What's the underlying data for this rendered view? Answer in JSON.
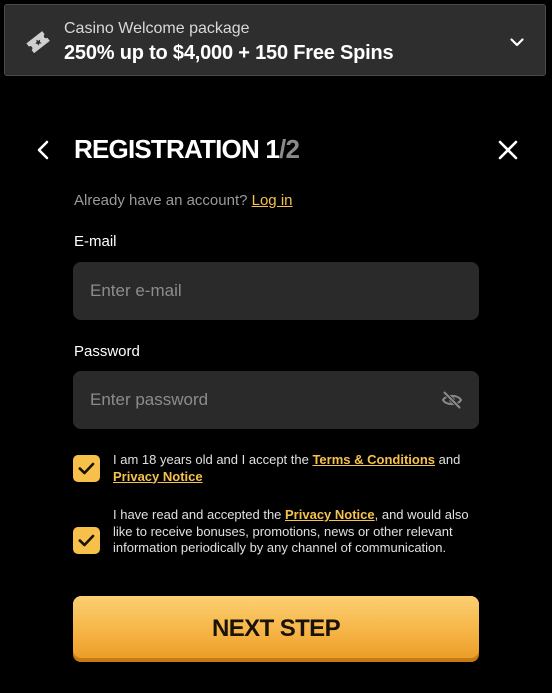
{
  "promo": {
    "subtitle": "Casino Welcome package",
    "headline": "250% up to $4,000 + 150 Free Spins"
  },
  "header": {
    "title_main": "REGISTRATION 1",
    "title_dim": "/2"
  },
  "account": {
    "prompt": "Already have an account?",
    "login_link": "Log in"
  },
  "email": {
    "label": "E-mail",
    "placeholder": "Enter e-mail",
    "value": ""
  },
  "password": {
    "label": "Password",
    "placeholder": "Enter password",
    "value": ""
  },
  "consent_terms": {
    "checked": true,
    "text_before": "I am 18 years old and I accept the ",
    "terms_link": "Terms & Conditions",
    "text_middle": " and ",
    "privacy_link": "Privacy Notice"
  },
  "consent_marketing": {
    "checked": true,
    "text_before": "I have read and accepted the ",
    "privacy_link": "Privacy Notice",
    "text_after": ", and would also like to receive bonuses, promotions, news or other relevant information periodically by any channel of communication."
  },
  "next_button": {
    "label": "NEXT STEP"
  },
  "colors": {
    "accent": "#f7c04a",
    "link": "#f5c24b",
    "background": "#000000",
    "field_bg": "#2a2a2a",
    "banner_bg": "#2e2e2e"
  },
  "icons": {
    "promo": "ticket-icon",
    "promo_toggle": "chevron-down-icon",
    "back": "chevron-left-icon",
    "close": "close-icon",
    "password_visibility": "eye-off-icon",
    "checkbox": "checkmark-icon"
  }
}
